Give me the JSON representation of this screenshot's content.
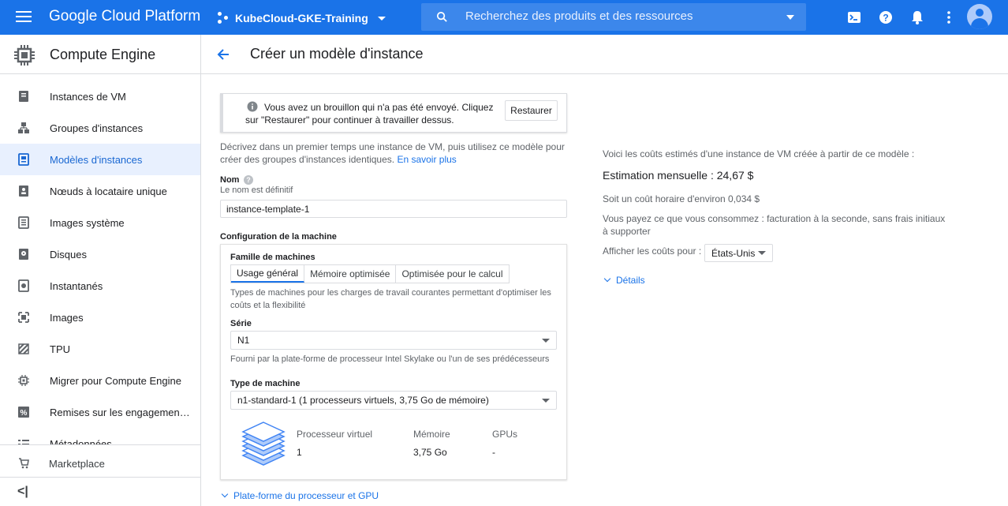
{
  "topbar": {
    "brand": "Google Cloud Platform",
    "project": "KubeCloud-GKE-Training",
    "search_placeholder": "Recherchez des produits et des ressources",
    "color": "#1a73e8"
  },
  "sidebar": {
    "title": "Compute Engine",
    "items": [
      {
        "label": "Instances de VM",
        "icon": "vm-instances-icon"
      },
      {
        "label": "Groupes d'instances",
        "icon": "instance-groups-icon"
      },
      {
        "label": "Modèles d'instances",
        "icon": "instance-templates-icon",
        "active": true
      },
      {
        "label": "Nœuds à locataire unique",
        "icon": "sole-tenant-icon"
      },
      {
        "label": "Images système",
        "icon": "machine-images-icon"
      },
      {
        "label": "Disques",
        "icon": "disks-icon"
      },
      {
        "label": "Instantanés",
        "icon": "snapshots-icon"
      },
      {
        "label": "Images",
        "icon": "images-icon"
      },
      {
        "label": "TPU",
        "icon": "tpu-icon"
      },
      {
        "label": "Migrer pour Compute Engine",
        "icon": "migrate-icon"
      },
      {
        "label": "Remises sur les engagements d'utilisation",
        "icon": "discount-icon"
      },
      {
        "label": "Métadonnées",
        "icon": "metadata-icon"
      }
    ],
    "marketplace": "Marketplace"
  },
  "page": {
    "title": "Créer un modèle d'instance"
  },
  "draft": {
    "message": "Vous avez un brouillon qui n'a pas été envoyé. Cliquez sur \"Restaurer\" pour continuer à travailler dessus.",
    "restore_label": "Restaurer"
  },
  "form": {
    "description": "Décrivez dans un premier temps une instance de VM, puis utilisez ce modèle pour créer des groupes d'instances identiques.",
    "learn_more": "En savoir plus",
    "name_label": "Nom",
    "name_hint": "Le nom est définitif",
    "name_value": "instance-template-1",
    "machine_config_label": "Configuration de la machine",
    "family_label": "Famille de machines",
    "tabs": [
      "Usage général",
      "Mémoire optimisée",
      "Optimisée pour le calcul"
    ],
    "family_hint": "Types de machines pour les charges de travail courantes permettant d'optimiser les coûts et la flexibilité",
    "series_label": "Série",
    "series_value": "N1",
    "series_hint": "Fourni par la plate-forme de processeur Intel Skylake ou l'un de ses prédécesseurs",
    "machine_type_label": "Type de machine",
    "machine_type_value": "n1-standard-1 (1 processeurs virtuels, 3,75 Go de mémoire)",
    "specs": {
      "vcpu_label": "Processeur virtuel",
      "vcpu_value": "1",
      "memory_label": "Mémoire",
      "memory_value": "3,75 Go",
      "gpu_label": "GPUs",
      "gpu_value": "-"
    },
    "cpu_platform_link": "Plate-forme du processeur et GPU"
  },
  "cost": {
    "intro": "Voici les coûts estimés d'une instance de VM créée à partir de ce modèle :",
    "monthly": "Estimation mensuelle : 24,67 $",
    "hourly": "Soit un coût horaire d'environ 0,034 $",
    "billing": "Vous payez ce que vous consommez : facturation à la seconde, sans frais initiaux à supporter",
    "show_costs_label": "Afficher les coûts pour :",
    "region": "États-Unis",
    "details": "Détails"
  }
}
